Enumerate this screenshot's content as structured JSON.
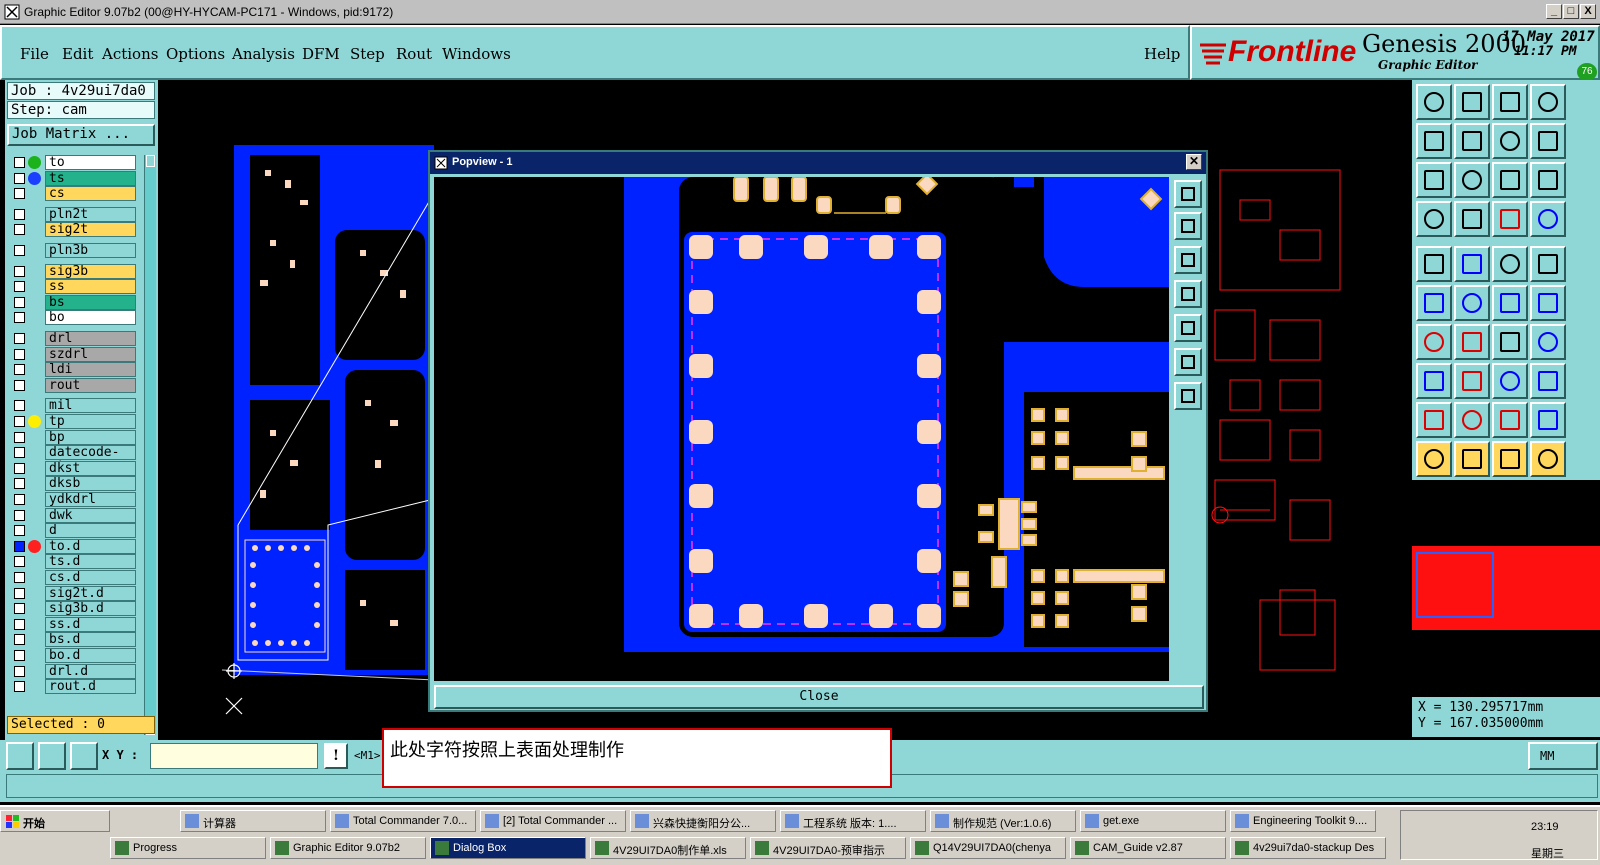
{
  "window": {
    "title": "Graphic Editor 9.07b2 (00@HY-HYCAM-PC171 - Windows, pid:9172)",
    "controls": [
      "_",
      "□",
      "X"
    ]
  },
  "menu": {
    "items": [
      "File",
      "Edit",
      "Actions",
      "Options",
      "Analysis",
      "DFM",
      "Step",
      "Rout",
      "Windows"
    ],
    "help": "Help"
  },
  "brand": {
    "logo": "Frontline",
    "product": "Genesis 2000",
    "subtitle": "Graphic Editor",
    "date": "17 May 2017",
    "time": "11:17 PM",
    "badge": "76"
  },
  "job": {
    "job_label": "Job : 4v29ui7da0",
    "step_label": "Step: cam",
    "matrix_button": "Job Matrix ..."
  },
  "layers": [
    {
      "name": "to",
      "bg": "#ffffff",
      "dot": "#1bb21b"
    },
    {
      "name": "ts",
      "bg": "#23b28c",
      "dot": "#1c3fff"
    },
    {
      "name": "cs",
      "bg": "#ffd75c",
      "dot": ""
    },
    {
      "name": "pln2t",
      "bg": "#8fd6d6",
      "dot": ""
    },
    {
      "name": "sig2t",
      "bg": "#ffd75c",
      "dot": ""
    },
    {
      "name": "pln3b",
      "bg": "#8fd6d6",
      "dot": ""
    },
    {
      "name": "sig3b",
      "bg": "#ffd75c",
      "dot": ""
    },
    {
      "name": "ss",
      "bg": "#ffd75c",
      "dot": ""
    },
    {
      "name": "bs",
      "bg": "#23b28c",
      "dot": ""
    },
    {
      "name": "bo",
      "bg": "#ffffff",
      "dot": ""
    },
    {
      "name": "drl",
      "bg": "#a8a8a8",
      "dot": ""
    },
    {
      "name": "szdrl",
      "bg": "#a8a8a8",
      "dot": ""
    },
    {
      "name": "ldi",
      "bg": "#a8a8a8",
      "dot": ""
    },
    {
      "name": "rout",
      "bg": "#a8a8a8",
      "dot": ""
    },
    {
      "name": "mil",
      "bg": "#8fd6d6",
      "dot": ""
    },
    {
      "name": "tp",
      "bg": "#8fd6d6",
      "dot": "#ffee00"
    },
    {
      "name": "bp",
      "bg": "#8fd6d6",
      "dot": ""
    },
    {
      "name": "datecode-pt",
      "bg": "#8fd6d6",
      "dot": ""
    },
    {
      "name": "dkst",
      "bg": "#8fd6d6",
      "dot": ""
    },
    {
      "name": "dksb",
      "bg": "#8fd6d6",
      "dot": ""
    },
    {
      "name": "ydkdrl",
      "bg": "#8fd6d6",
      "dot": ""
    },
    {
      "name": "dwk",
      "bg": "#8fd6d6",
      "dot": ""
    },
    {
      "name": "d",
      "bg": "#8fd6d6",
      "dot": ""
    },
    {
      "name": "to.d",
      "bg": "#8fd6d6",
      "dot": "#ff2020"
    },
    {
      "name": "ts.d",
      "bg": "#8fd6d6",
      "dot": ""
    },
    {
      "name": "cs.d",
      "bg": "#8fd6d6",
      "dot": ""
    },
    {
      "name": "sig2t.d",
      "bg": "#8fd6d6",
      "dot": ""
    },
    {
      "name": "sig3b.d",
      "bg": "#8fd6d6",
      "dot": ""
    },
    {
      "name": "ss.d",
      "bg": "#8fd6d6",
      "dot": ""
    },
    {
      "name": "bs.d",
      "bg": "#8fd6d6",
      "dot": ""
    },
    {
      "name": "bo.d",
      "bg": "#8fd6d6",
      "dot": ""
    },
    {
      "name": "drl.d",
      "bg": "#8fd6d6",
      "dot": ""
    },
    {
      "name": "rout.d",
      "bg": "#8fd6d6",
      "dot": ""
    }
  ],
  "selected": "Selected : 0",
  "popview": {
    "title": "Popview - 1",
    "close": "Close"
  },
  "coords": {
    "x": "X = 130.295717mm",
    "y": "Y = 167.035000mm"
  },
  "status": {
    "xy_label": "X Y :",
    "xy_value": "",
    "mode": "<M1>",
    "units": "MM"
  },
  "note": "此处字符按照上表面处理制作",
  "taskbar": {
    "start": "开始",
    "row1": [
      "计算器",
      "Total Commander 7.0...",
      "[2] Total Commander ...",
      "兴森快捷衡阳分公...",
      "工程系统  版本: 1....",
      "制作规范 (Ver:1.0.6)",
      "get.exe",
      "Engineering Toolkit 9...."
    ],
    "row2": [
      "Progress",
      "Graphic Editor 9.07b2",
      "Dialog Box",
      "4V29UI7DA0制作单.xls",
      "4V29UI7DA0-预审指示",
      "Q14V29UI7DA0(chenya",
      "CAM_Guide v2.87",
      "4v29ui7da0-stackup Des"
    ],
    "clock": "23:19",
    "day": "星期三"
  },
  "colors": {
    "panel": "#8fd6d6",
    "copper": "#0022ff",
    "pad": "#fad9c0",
    "silk": "#e0b030",
    "outline": "#ff1010"
  }
}
